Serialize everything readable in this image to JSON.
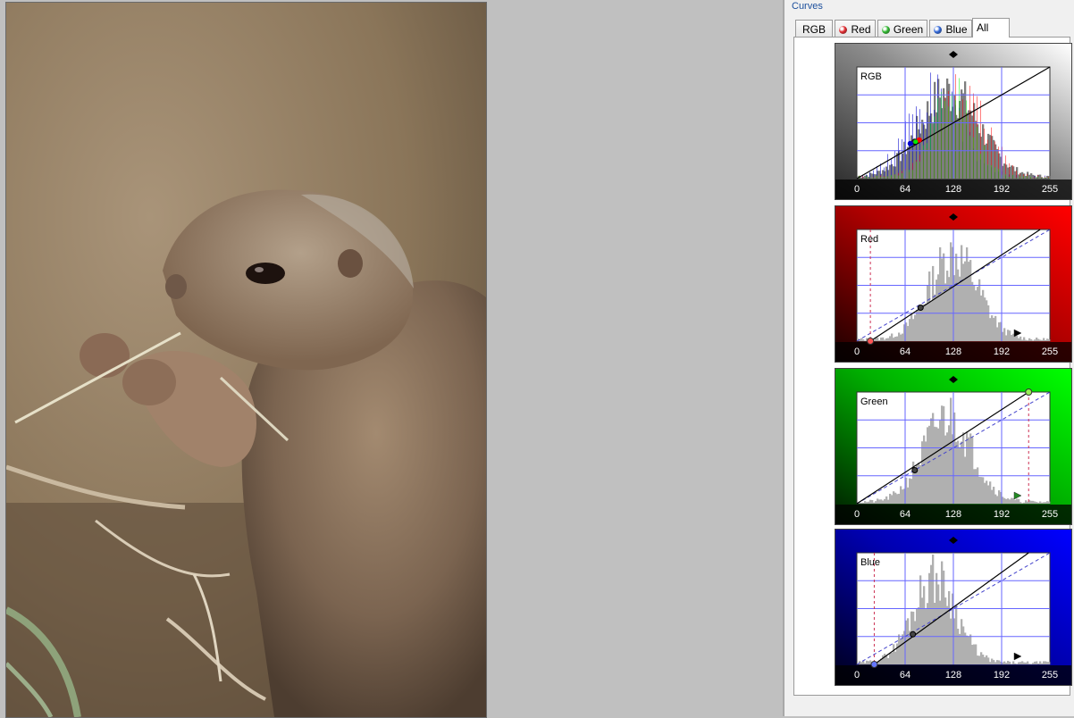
{
  "panel": {
    "title": "Curves"
  },
  "tabs": [
    {
      "label": "RGB",
      "dot": ""
    },
    {
      "label": "Red",
      "dot": "#e0262b"
    },
    {
      "label": "Green",
      "dot": "#2bb52b"
    },
    {
      "label": "Blue",
      "dot": "#2c63d6"
    },
    {
      "label": "All",
      "dot": ""
    }
  ],
  "active_tab": "All",
  "curves": [
    {
      "channel": "RGB",
      "label": "RGB",
      "theme": "gray",
      "ticks": [
        "0",
        "64",
        "128",
        "192",
        "255"
      ]
    },
    {
      "channel": "Red",
      "label": "Red",
      "theme": "red",
      "ticks": [
        "0",
        "64",
        "128",
        "192",
        "255"
      ]
    },
    {
      "channel": "Green",
      "label": "Green",
      "theme": "green",
      "ticks": [
        "0",
        "64",
        "128",
        "192",
        "255"
      ]
    },
    {
      "channel": "Blue",
      "label": "Blue",
      "theme": "blue",
      "ticks": [
        "0",
        "64",
        "128",
        "192",
        "255"
      ]
    }
  ],
  "colors": {
    "red_channel": "#ff0000",
    "green_channel": "#00ee00",
    "blue_channel": "#0000cc",
    "grid": "#6666ff",
    "panel_title": "#1c4f9c"
  }
}
